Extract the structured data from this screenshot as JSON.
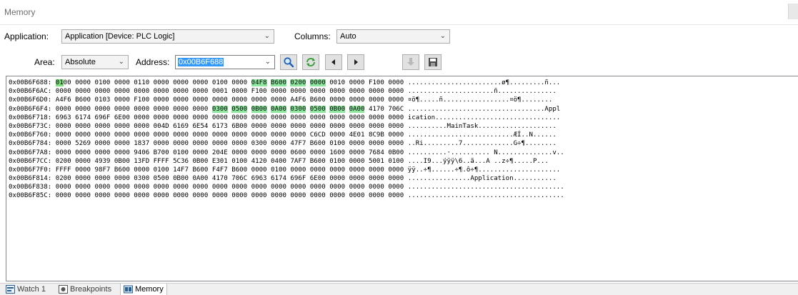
{
  "window": {
    "title": "Memory"
  },
  "toolbar": {
    "application_label": "Application:",
    "application_value": "Application [Device: PLC Logic]",
    "columns_label": "Columns:",
    "columns_value": "Auto",
    "area_label": "Area:",
    "area_value": "Absolute",
    "address_label": "Address:",
    "address_value": "0x00B6F688",
    "buttons": [
      "search-icon",
      "refresh-icon",
      "previous-icon",
      "next-icon",
      "download-icon",
      "save-icon"
    ]
  },
  "memory": {
    "rows": [
      {
        "addr": "0x00B6F688:",
        "words": [
          "0100",
          "0000",
          "0100",
          "0000",
          "0110",
          "0000",
          "0000",
          "0000",
          "0100",
          "0000",
          "04F8",
          "B600",
          "0200",
          "0000",
          "0010",
          "0000",
          "F100",
          "0000"
        ],
        "ascii": "........................ø¶.........ñ..."
      },
      {
        "addr": "0x00B6F6AC:",
        "words": [
          "0000",
          "0000",
          "0000",
          "0000",
          "0000",
          "0000",
          "0000",
          "0000",
          "0001",
          "0000",
          "F100",
          "0000",
          "0000",
          "0000",
          "0000",
          "0000",
          "0000",
          "0000"
        ],
        "ascii": "......................ñ..............."
      },
      {
        "addr": "0x00B6F6D0:",
        "words": [
          "A4F6",
          "B600",
          "0103",
          "0000",
          "F100",
          "0000",
          "0000",
          "0000",
          "0000",
          "0000",
          "0000",
          "0000",
          "A4F6",
          "B600",
          "0000",
          "0000",
          "0000",
          "0000"
        ],
        "ascii": "¤ö¶.....ñ.................¤ö¶........"
      },
      {
        "addr": "0x00B6F6F4:",
        "words": [
          "0000",
          "0000",
          "0000",
          "0000",
          "0000",
          "0000",
          "0000",
          "0000",
          "0300",
          "0500",
          "0B00",
          "0A00",
          "0300",
          "0500",
          "0B00",
          "0A00",
          "4170",
          "706C"
        ],
        "ascii": "...................................Appl"
      },
      {
        "addr": "0x00B6F718:",
        "words": [
          "6963",
          "6174",
          "696F",
          "6E00",
          "0000",
          "0000",
          "0000",
          "0000",
          "0000",
          "0000",
          "0000",
          "0000",
          "0000",
          "0000",
          "0000",
          "0000",
          "0000",
          "0000"
        ],
        "ascii": "ication................................"
      },
      {
        "addr": "0x00B6F73C:",
        "words": [
          "0000",
          "0000",
          "0000",
          "0000",
          "0000",
          "004D",
          "6169",
          "6E54",
          "6173",
          "6B00",
          "0000",
          "0000",
          "0000",
          "0000",
          "0000",
          "0000",
          "0000",
          "0000"
        ],
        "ascii": "..........MainTask...................."
      },
      {
        "addr": "0x00B6F760:",
        "words": [
          "0000",
          "0000",
          "0000",
          "0000",
          "0000",
          "0000",
          "0000",
          "0000",
          "0000",
          "0000",
          "0000",
          "0000",
          "0000",
          "C6CD",
          "0000",
          "4E01",
          "8C9B",
          "0000"
        ],
        "ascii": "...........................ÆÍ..N......"
      },
      {
        "addr": "0x00B6F784:",
        "words": [
          "0000",
          "5269",
          "0000",
          "0000",
          "1837",
          "0000",
          "0000",
          "0000",
          "0000",
          "0000",
          "0300",
          "0000",
          "47F7",
          "B600",
          "0100",
          "0000",
          "0000",
          "0000"
        ],
        "ascii": "..Ri.........7.............G÷¶........"
      },
      {
        "addr": "0x00B6F7A8:",
        "words": [
          "0000",
          "0000",
          "0000",
          "0000",
          "9406",
          "B700",
          "0100",
          "0000",
          "204E",
          "0000",
          "0000",
          "0000",
          "0600",
          "0000",
          "1600",
          "0000",
          "7684",
          "0B00"
        ],
        "ascii": "..........·.......... N..............v.."
      },
      {
        "addr": "0x00B6F7CC:",
        "words": [
          "0200",
          "0000",
          "4939",
          "0B00",
          "13FD",
          "FFFF",
          "5C36",
          "0B00",
          "E301",
          "0100",
          "4120",
          "0400",
          "7AF7",
          "B600",
          "0100",
          "0000",
          "5001",
          "0100"
        ],
        "ascii": "....I9...ýÿÿ\\6..ã...A ..z÷¶.....P..."
      },
      {
        "addr": "0x00B6F7F0:",
        "words": [
          "FFFF",
          "0000",
          "98F7",
          "B600",
          "0000",
          "0100",
          "14F7",
          "B600",
          "F4F7",
          "B600",
          "0000",
          "0100",
          "0000",
          "0000",
          "0000",
          "0000",
          "0000",
          "0000"
        ],
        "ascii": "ÿÿ..÷¶......÷¶.ô÷¶....................."
      },
      {
        "addr": "0x00B6F814:",
        "words": [
          "0200",
          "0000",
          "0000",
          "0000",
          "0300",
          "0500",
          "0B00",
          "0A00",
          "4170",
          "706C",
          "6963",
          "6174",
          "696F",
          "6E00",
          "0000",
          "0000",
          "0000",
          "0000"
        ],
        "ascii": "................Application..........."
      },
      {
        "addr": "0x00B6F838:",
        "words": [
          "0000",
          "0000",
          "0000",
          "0000",
          "0000",
          "0000",
          "0000",
          "0000",
          "0000",
          "0000",
          "0000",
          "0000",
          "0000",
          "0000",
          "0000",
          "0000",
          "0000",
          "0000"
        ],
        "ascii": "........................................"
      },
      {
        "addr": "0x00B6F85C:",
        "words": [
          "0000",
          "0000",
          "0000",
          "0000",
          "0000",
          "0000",
          "0000",
          "0000",
          "0000",
          "0000",
          "0000",
          "0000",
          "0000",
          "0000",
          "0000",
          "0000",
          "0000",
          "0000"
        ],
        "ascii": "........................................"
      }
    ]
  },
  "tabs": [
    {
      "label": "Watch 1",
      "icon": "watch-icon",
      "active": false
    },
    {
      "label": "Breakpoints",
      "icon": "breakpoints-icon",
      "active": false
    },
    {
      "label": "Memory",
      "icon": "memory-icon",
      "active": true
    }
  ]
}
